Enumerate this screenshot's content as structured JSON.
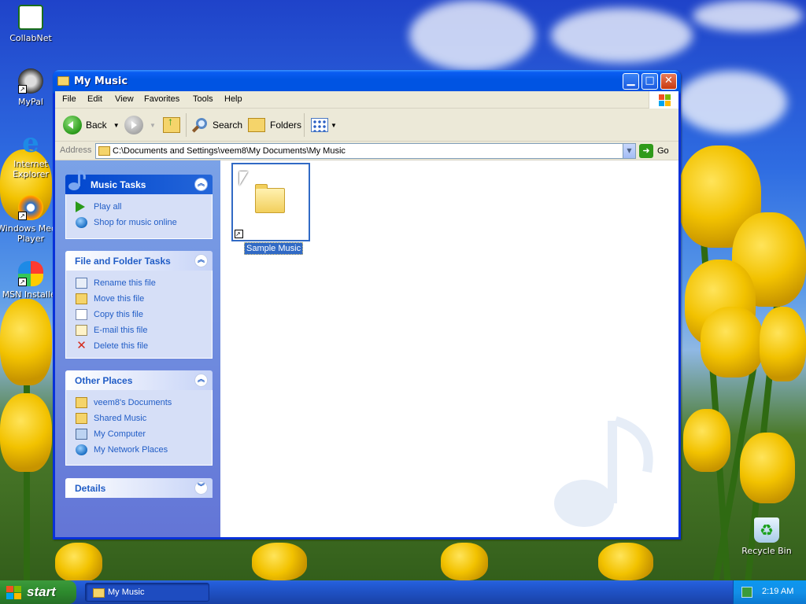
{
  "desktop": {
    "icons": [
      {
        "label": "CollabNet"
      },
      {
        "label": "MyPal"
      },
      {
        "label": "Internet Explorer"
      },
      {
        "label": "Windows Media Player"
      },
      {
        "label": "MSN Installer"
      },
      {
        "label": "Recycle Bin"
      }
    ]
  },
  "window": {
    "title": "My Music",
    "menu": [
      "File",
      "Edit",
      "View",
      "Favorites",
      "Tools",
      "Help"
    ],
    "toolbar": {
      "back_label": "Back",
      "search_label": "Search",
      "folders_label": "Folders"
    },
    "address": {
      "label": "Address",
      "value": "C:\\Documents and Settings\\veem8\\My Documents\\My Music",
      "go_label": "Go"
    },
    "panels": {
      "music_tasks": {
        "title": "Music Tasks",
        "items": [
          "Play all",
          "Shop for music online"
        ]
      },
      "file_folder_tasks": {
        "title": "File and Folder Tasks",
        "items": [
          "Rename this file",
          "Move this file",
          "Copy this file",
          "E-mail this file",
          "Delete this file"
        ]
      },
      "other_places": {
        "title": "Other Places",
        "items": [
          "veem8's Documents",
          "Shared Music",
          "My Computer",
          "My Network Places"
        ]
      },
      "details": {
        "title": "Details"
      }
    },
    "content": {
      "items": [
        {
          "label": "Sample Music",
          "selected": true
        }
      ]
    }
  },
  "taskbar": {
    "start_label": "start",
    "task_label": "My Music",
    "clock": "2:19 AM"
  },
  "colors": {
    "title_bar": "#0054e3",
    "link_blue": "#215dc6",
    "selection": "#316ac5",
    "start_green": "#2d8a2d"
  }
}
